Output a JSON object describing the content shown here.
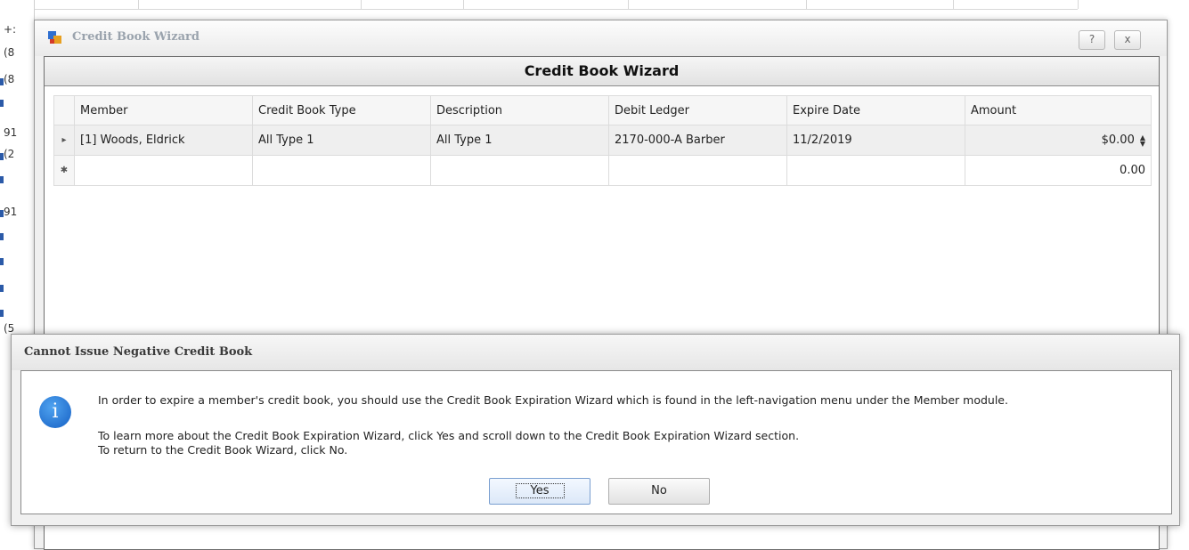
{
  "background": {
    "left_cells": [
      "+:",
      "(8",
      "(8",
      "91",
      "(2",
      "91",
      "(5"
    ]
  },
  "wizard": {
    "window_title": "Credit Book Wizard",
    "help_label": "?",
    "close_label": "x",
    "header": "Credit Book Wizard",
    "columns": [
      "Member",
      "Credit Book Type",
      "Description",
      "Debit Ledger",
      "Expire Date",
      "Amount"
    ],
    "rows": [
      {
        "indicator": "▸",
        "member": "[1] Woods, Eldrick",
        "type": "All Type 1",
        "description": "All Type 1",
        "ledger": "2170-000-A Barber",
        "expire": "11/2/2019",
        "amount": "$0.00"
      }
    ],
    "new_row": {
      "indicator": "✱",
      "amount": "0.00"
    }
  },
  "dialog": {
    "title": "Cannot Issue Negative Credit Book",
    "icon": "info-icon",
    "icon_glyph": "i",
    "line1": "In order to expire a member's credit book, you should use the Credit Book Expiration Wizard which is found in the left-navigation menu under the Member module.",
    "line2": "To learn more about the Credit Book Expiration Wizard, click Yes and scroll down to the Credit Book Expiration Wizard section.",
    "line3": "To return to the Credit Book Wizard, click No.",
    "yes_label": "Yes",
    "no_label": "No"
  }
}
